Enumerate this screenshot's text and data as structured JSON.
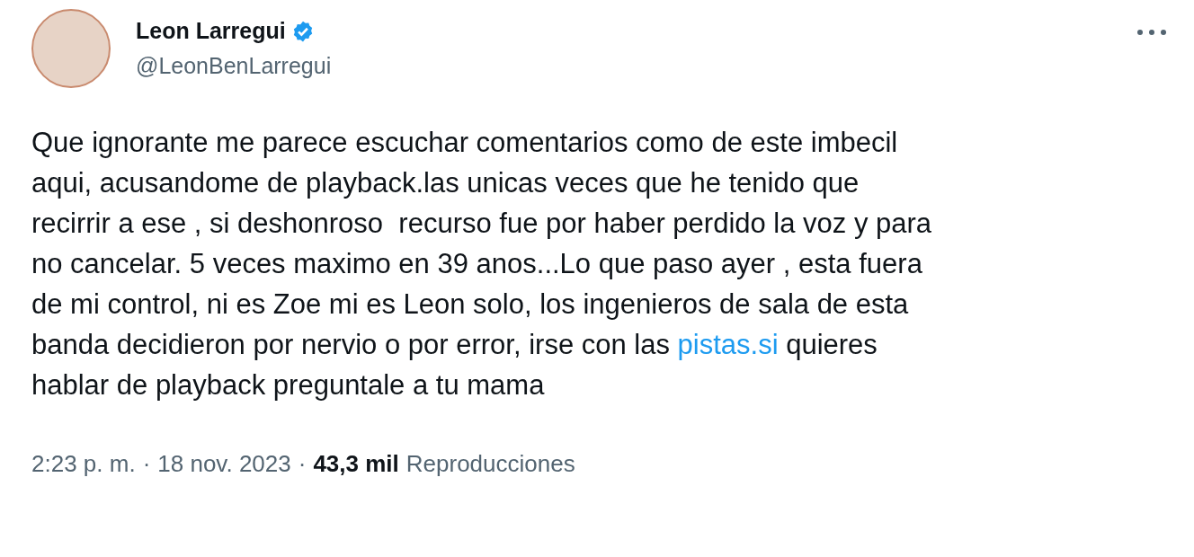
{
  "author": {
    "name": "Leon Larregui",
    "handle": "@LeonBenLarregui",
    "verified": true
  },
  "body": [
    {
      "kind": "text",
      "text": "Que ignorante me parece escuchar comentarios como de este imbecil\naqui, acusandome de playback.las unicas veces que he tenido que\nrecirrir a ese , si deshonroso  recurso fue por haber perdido la voz y para\nno cancelar. 5 veces maximo en 39 anos...Lo que paso ayer , esta fuera\nde mi control, ni es Zoe mi es Leon solo, los ingenieros de sala de esta\nbanda decidieron por nervio o por error, irse con las "
    },
    {
      "kind": "link",
      "text": "pistas.si"
    },
    {
      "kind": "text",
      "text": " quieres\nhablar de playback preguntale a tu mama"
    }
  ],
  "meta": {
    "time": "2:23 p. m.",
    "separators": [
      "·",
      "·"
    ],
    "date": "18 nov. 2023",
    "views": "43,3 mil",
    "views_label": "Reproducciones"
  }
}
